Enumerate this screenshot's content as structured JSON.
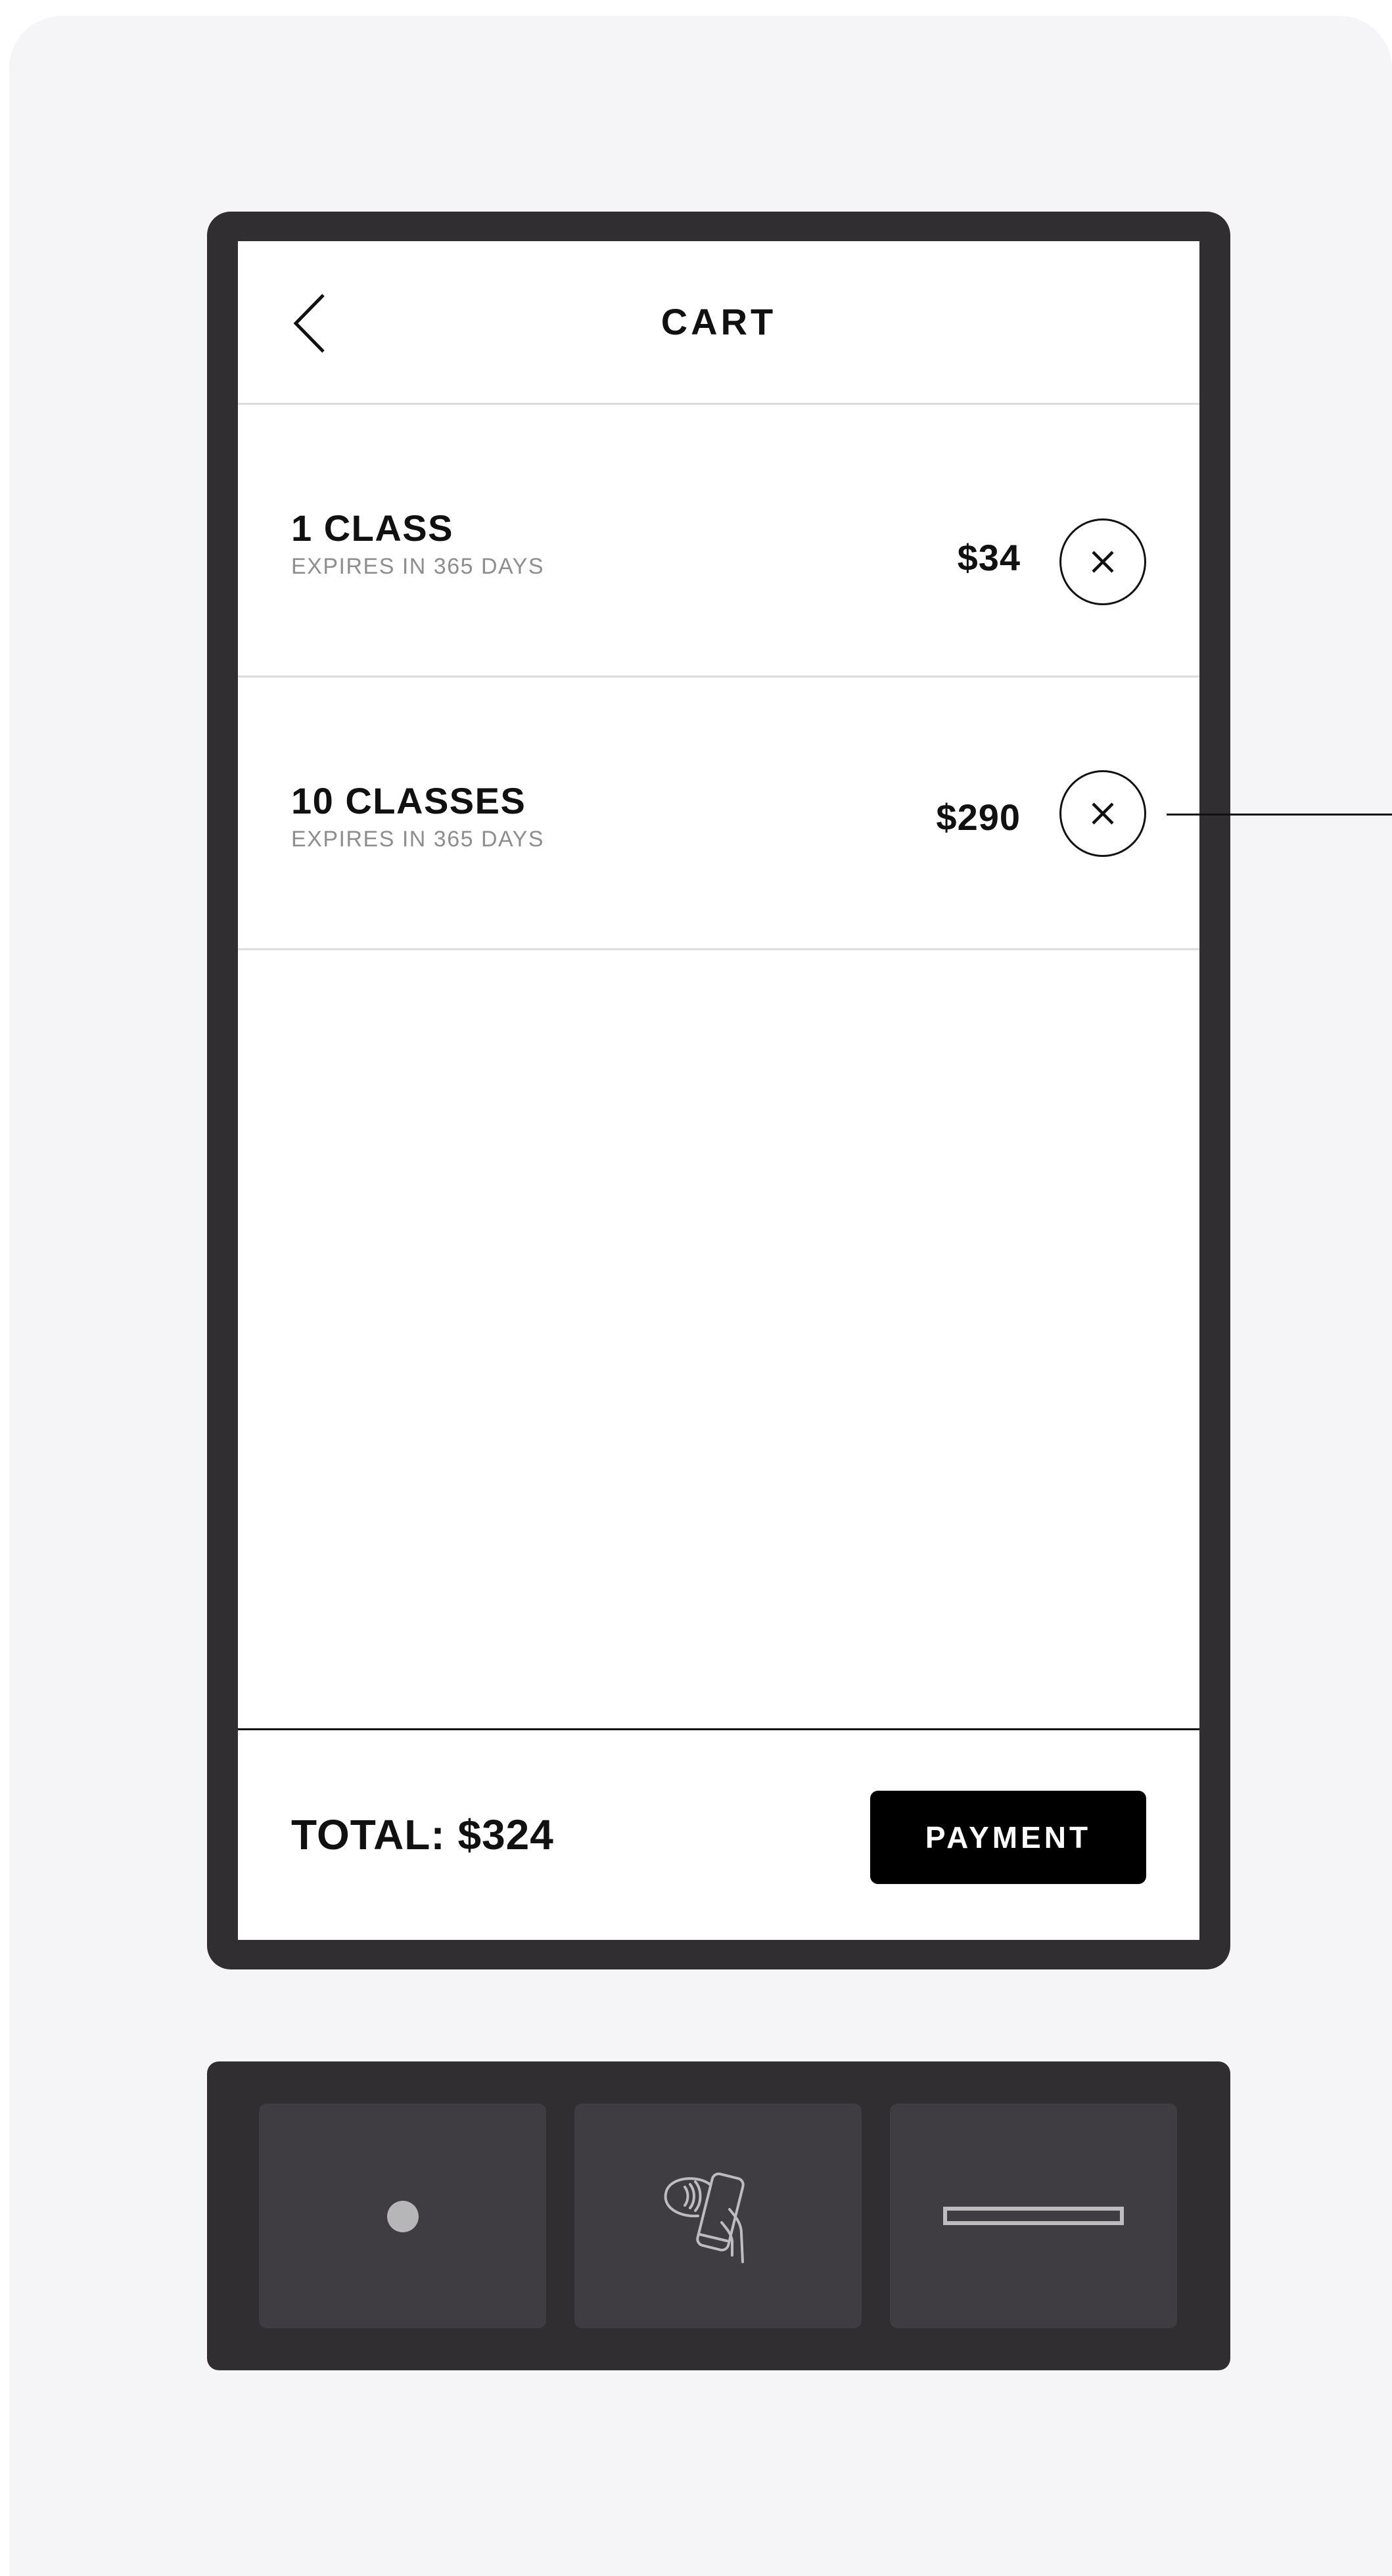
{
  "header": {
    "title": "CART",
    "back_icon": "chevron-left-icon"
  },
  "cart": {
    "items": [
      {
        "name": "1 CLASS",
        "subtitle": "EXPIRES IN 365 DAYS",
        "price": "$34",
        "remove_icon": "close-icon"
      },
      {
        "name": "10 CLASSES",
        "subtitle": "EXPIRES IN 365 DAYS",
        "price": "$290",
        "remove_icon": "close-icon"
      }
    ]
  },
  "footer": {
    "total_label": "TOTAL: $324",
    "payment_label": "PAYMENT"
  },
  "hardware": {
    "slots": [
      {
        "icon": "indicator-dot-icon"
      },
      {
        "icon": "contactless-pay-icon"
      },
      {
        "icon": "card-slot-icon"
      }
    ]
  },
  "colors": {
    "bezel": "#302e31",
    "slot": "#3f3d41",
    "primary_button": "#000000",
    "muted_text": "#8e8e8e",
    "background": "#f5f4f6"
  }
}
